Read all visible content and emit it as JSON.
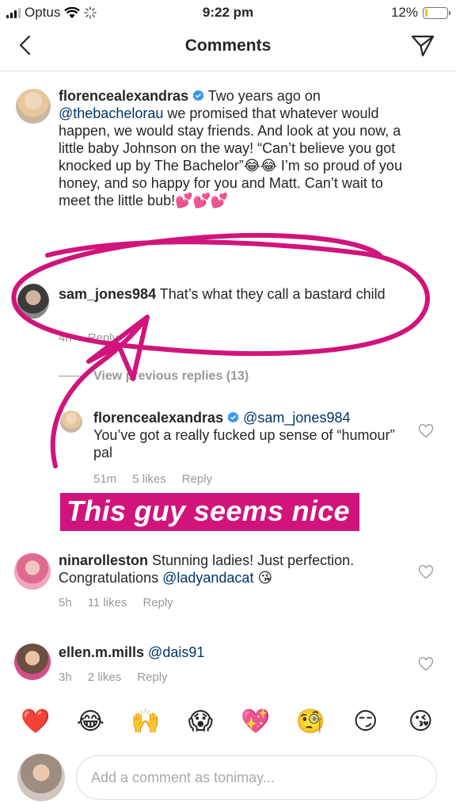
{
  "status_bar": {
    "carrier": "Optus",
    "time": "9:22 pm",
    "battery": "12%",
    "battery_level": 0.12
  },
  "header": {
    "title": "Comments",
    "back_icon": "chevron-left-icon",
    "share_icon": "paper-plane-icon"
  },
  "comments": [
    {
      "username": "florencealexandras",
      "verified": true,
      "parts": [
        {
          "t": " Two years ago on "
        },
        {
          "t": "@thebachelorau",
          "m": true
        },
        {
          "t": " we promised that whatever would happen, we would stay friends. And look at you now, a little baby Johnson on the way! “Can’t believe you got knocked up by The Bachelor”😂😂 I’m so proud of you honey, and so happy for you and Matt. Can’t wait to meet the little bub!💕💕💕"
        }
      ]
    },
    {
      "username": "sam_jones984",
      "text": " That’s what they call a bastard child",
      "time": "4h",
      "reply": "Reply"
    }
  ],
  "view_previous": "View previous replies (13)",
  "reply_comment": {
    "username": "florencealexandras",
    "verified": true,
    "mention": "@sam_jones984",
    "text": "You’ve got a really fucked up sense of “humour” pal",
    "time": "51m",
    "likes": "5 likes",
    "reply": "Reply"
  },
  "caption": "This guy seems nice",
  "comment_nina": {
    "username": "ninarolleston",
    "text": " Stunning ladies! Just perfection. Congratulations ",
    "mention": "@ladyandacat",
    "emoji": " 😘",
    "time": "5h",
    "likes": "11 likes",
    "reply": "Reply"
  },
  "comment_ellen": {
    "username": "ellen.m.mills",
    "mention": " @dais91",
    "time": "3h",
    "likes": "2 likes",
    "reply": "Reply"
  },
  "emoji_bar": [
    "❤️",
    "😂",
    "🙌",
    "😱",
    "💖",
    "🧐",
    "😏",
    "😘"
  ],
  "input": {
    "placeholder": "Add a comment as tonimay..."
  },
  "colors": {
    "accent_annotation": "#d0147b",
    "mention": "#003569",
    "verified": "#3897f0",
    "meta": "#999999"
  }
}
